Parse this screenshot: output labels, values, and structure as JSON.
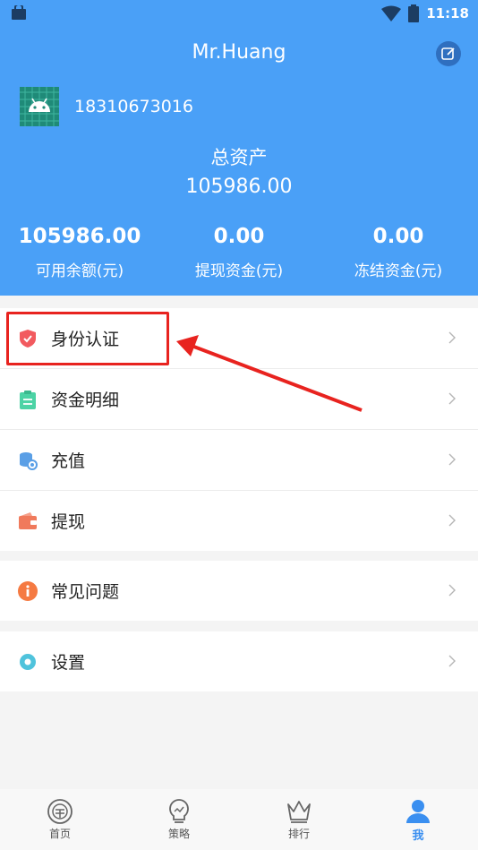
{
  "status_bar": {
    "time": "11:18"
  },
  "header": {
    "username": "Mr.Huang",
    "phone": "18310673016",
    "total_assets_label": "总资产",
    "total_assets_value": "105986.00",
    "stats": [
      {
        "value": "105986.00",
        "label": "可用余额(元)"
      },
      {
        "value": "0.00",
        "label": "提现资金(元)"
      },
      {
        "value": "0.00",
        "label": "冻结资金(元)"
      }
    ]
  },
  "menu": {
    "group1": [
      {
        "label": "身份认证",
        "icon": "shield-icon"
      },
      {
        "label": "资金明细",
        "icon": "clipboard-icon"
      },
      {
        "label": "充值",
        "icon": "coins-icon"
      },
      {
        "label": "提现",
        "icon": "wallet-icon"
      }
    ],
    "group2": [
      {
        "label": "常见问题",
        "icon": "info-icon"
      }
    ],
    "group3": [
      {
        "label": "设置",
        "icon": "gear-icon"
      }
    ]
  },
  "tabbar": [
    {
      "label": "首页",
      "icon": "home-coin-icon"
    },
    {
      "label": "策略",
      "icon": "bulb-icon"
    },
    {
      "label": "排行",
      "icon": "crown-icon"
    },
    {
      "label": "我",
      "icon": "user-icon"
    }
  ],
  "colors": {
    "primary": "#4aa0f7",
    "annotation": "#e8231f",
    "active_tab": "#3a8ff0"
  }
}
